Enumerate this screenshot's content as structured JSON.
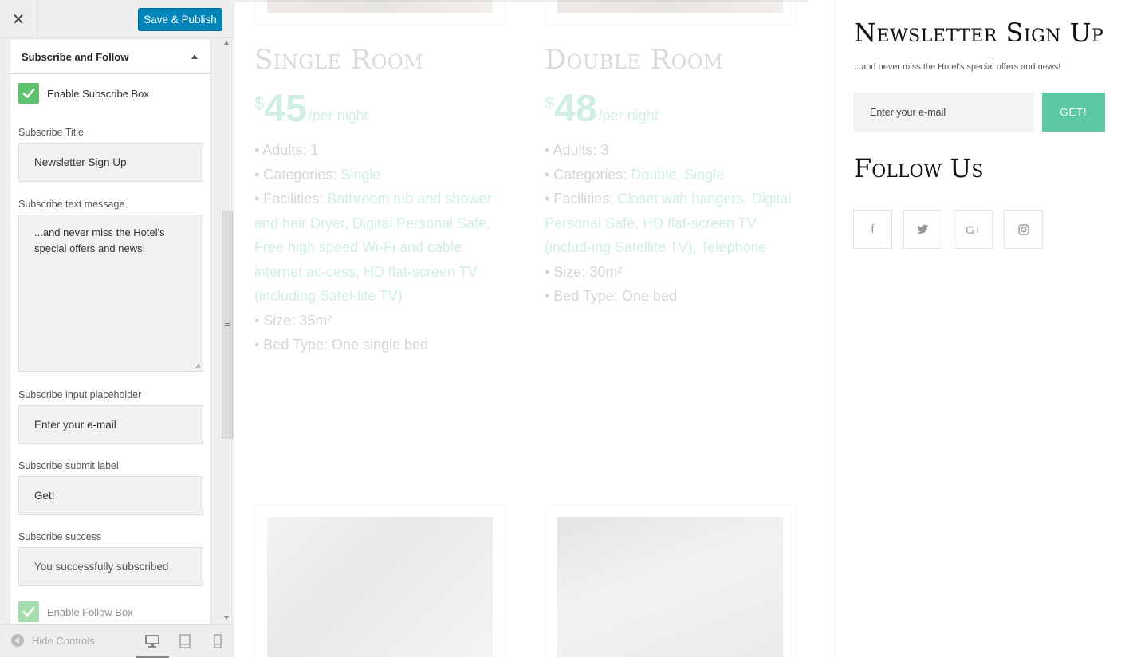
{
  "customizer": {
    "close_glyph": "✕",
    "publish_label": "Save & Publish",
    "section_title": "Subscribe and Follow",
    "enable_subscribe_label": "Enable Subscribe Box",
    "subscribe_title_label": "Subscribe Title",
    "subscribe_title_value": "Newsletter Sign Up",
    "subscribe_text_label": "Subscribe text message",
    "subscribe_text_value": "...and never miss the Hotel's special offers and news!",
    "placeholder_label": "Subscribe input placeholder",
    "placeholder_value": "Enter your e-mail",
    "submit_label_label": "Subscribe submit label",
    "submit_label_value": "Get!",
    "success_label": "Subscribe success",
    "success_value": "You successfully subscribed",
    "enable_follow_label": "Enable Follow Box",
    "hide_controls_label": "Hide Controls",
    "accent_color": "#0085ba",
    "check_color": "#5cc26e"
  },
  "preview": {
    "rooms": [
      {
        "title": "Single Room",
        "currency": "$",
        "price": "45",
        "per": "/per night",
        "adults": "• Adults: 1",
        "categories_label": "• Categories: ",
        "categories": "Single",
        "facilities_label": "• Facilities: ",
        "facilities": "Bathroom tub and shower and hair Dryer, Digital Personal Safe, Free high speed Wi-Fi and cable internet ac-cess, HD flat-screen TV (including Satel-lite TV)",
        "size": "• Size: 35m²",
        "bed": "• Bed Type: One single bed"
      },
      {
        "title": "Double Room",
        "currency": "$",
        "price": "48",
        "per": "/per night",
        "adults": "• Adults: 3",
        "categories_label": "• Categories: ",
        "categories": "Double, Single",
        "facilities_label": "• Facilities: ",
        "facilities": "Closet with hangers, Digital Personal Safe, HD flat-screen TV (includ-ing Satellite TV), Telephone",
        "size": "• Size: 30m²",
        "bed": "• Bed Type: One bed"
      }
    ],
    "newsletter_title": "Newsletter Sign Up",
    "newsletter_message": "...and never miss the Hotel's special offers and news!",
    "email_placeholder": "Enter your e-mail",
    "submit_button": "GET!",
    "follow_title": "Follow Us",
    "social_icons": [
      "facebook-icon",
      "twitter-icon",
      "google-plus-icon",
      "instagram-icon"
    ],
    "social_glyphs": [
      "f",
      "🐦",
      "G+",
      "◎"
    ],
    "accent_color": "#5cc8a6"
  }
}
